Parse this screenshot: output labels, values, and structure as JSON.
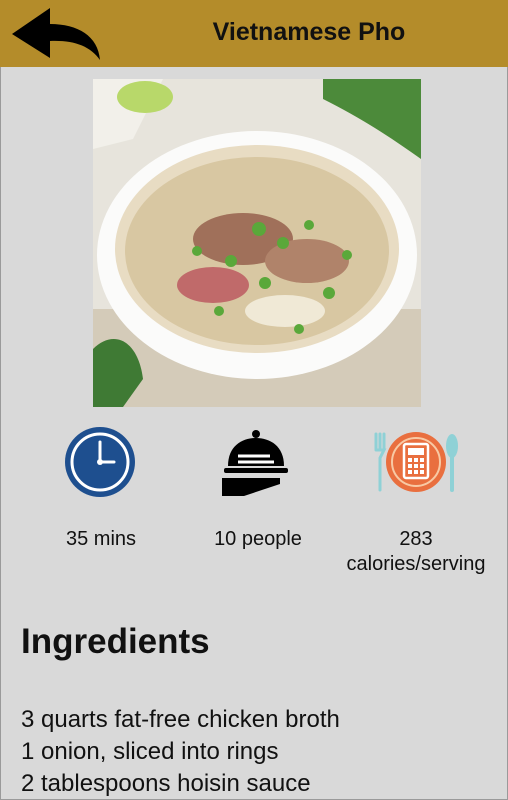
{
  "header": {
    "title": "Vietnamese Pho",
    "back_icon": "back-arrow-icon"
  },
  "hero": {
    "alt": "Bowl of Vietnamese pho",
    "icon": "pho-bowl-photo"
  },
  "stats": [
    {
      "icon": "clock-icon",
      "label": "35 mins"
    },
    {
      "icon": "serving-cloche-icon",
      "label": "10 people"
    },
    {
      "icon": "calories-calculator-icon",
      "label": "283\ncalories/serving"
    }
  ],
  "ingredients": {
    "heading": "Ingredients",
    "items": [
      "3 quarts fat-free chicken broth",
      "1 onion, sliced into rings",
      "2 tablespoons hoisin sauce"
    ]
  },
  "colors": {
    "header": "#b48c2a",
    "background": "#d9d9d9",
    "clock": "#1e4f8f",
    "plate": "#e96f3f",
    "cutlery": "#8fd1d6"
  }
}
